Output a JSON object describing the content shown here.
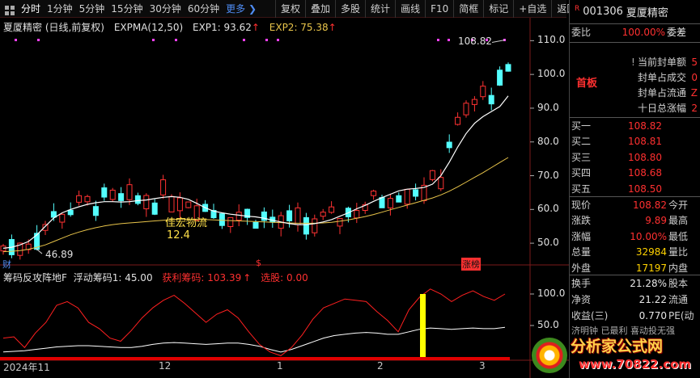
{
  "toolbar": {
    "periods": [
      "分时",
      "1分钟",
      "5分钟",
      "15分钟",
      "30分钟",
      "60分钟"
    ],
    "more": "更多 ❯",
    "actions": [
      "复权",
      "叠加",
      "多股",
      "统计",
      "画线",
      "F10",
      "简框",
      "标记",
      "+自选",
      "返回"
    ]
  },
  "chart": {
    "title": "夏厦精密 (日线,前复权)",
    "indicator": "EXPMA(12,50)",
    "exp1_label": "EXP1: 93.62",
    "exp2_label": "EXP2: 75.38",
    "arrow_up": "↑",
    "high_label": "108.82",
    "low_label": "46.89",
    "annotation_name": "佳宏物流",
    "annotation_value": "12.4",
    "marker_cai": "财",
    "marker_s": "$",
    "marker_zhangbang": "涨榜",
    "price_axis": [
      "110.0",
      "100.0",
      "90.0",
      "80.0",
      "70.0",
      "60.0",
      "50.0"
    ],
    "colors": {
      "up": "#ff3232",
      "down": "#54ffff",
      "exp1": "#ffffff",
      "exp2": "#e8c44a",
      "magenta": "#ff40ff"
    }
  },
  "indicator": {
    "title": "筹码反攻阵地F",
    "float_label": "浮动筹码1: 45.00",
    "profit_label": "获利筹码: 103.39",
    "select_label": "选股: 0.00",
    "axis": [
      "100.0",
      "50.0"
    ],
    "x_labels": [
      "2024年11",
      "12",
      "1",
      "2",
      "3"
    ]
  },
  "chart_data": {
    "type": "line",
    "ylim": [
      45,
      112
    ],
    "series": [
      {
        "name": "EXP1",
        "values": [
          48.5,
          48.8,
          49.5,
          50.5,
          52.5,
          55,
          57.5,
          59,
          60,
          60.8,
          61.5,
          62,
          62.3,
          62.3,
          62.2,
          62.3,
          62.6,
          62.8,
          63.2,
          63.6,
          63.8,
          63.6,
          63,
          61.8,
          60.5,
          59.5,
          59,
          58.6,
          58.3,
          58,
          57.8,
          57.4,
          56.8,
          56.3,
          55.8,
          55.5,
          55.5,
          55.8,
          56.3,
          57,
          58,
          59,
          60.2,
          61.2,
          62.4,
          63.5,
          64.5,
          65.5,
          66,
          66.2,
          66.5,
          67.5,
          70,
          74,
          78.5,
          82.5,
          85.5,
          87.5,
          89,
          90.5,
          93.62
        ]
      },
      {
        "name": "EXP2",
        "values": [
          47.5,
          47.6,
          47.8,
          48.2,
          48.8,
          49.5,
          50.5,
          51.5,
          52.5,
          53.3,
          54,
          54.6,
          55.1,
          55.5,
          55.8,
          56,
          56.2,
          56.4,
          56.6,
          56.8,
          57,
          57.1,
          57.1,
          57.1,
          57,
          56.9,
          56.8,
          56.7,
          56.6,
          56.5,
          56.4,
          56.3,
          56.2,
          56.1,
          56,
          55.9,
          55.9,
          55.9,
          56,
          56.2,
          56.5,
          56.9,
          57.4,
          57.9,
          58.5,
          59.2,
          59.9,
          60.6,
          61.3,
          62,
          62.7,
          63.4,
          64.3,
          65.4,
          66.7,
          68.1,
          69.5,
          70.9,
          72.4,
          73.9,
          75.38
        ]
      }
    ]
  },
  "panel": {
    "code": "001306",
    "name": "夏厦精密",
    "r_badge": "R",
    "weibi_label": "委比",
    "weibi_value": "100.00%",
    "weicha_label": "委差",
    "seal_rows": [
      {
        "label": "当前封单额",
        "value": "5"
      },
      {
        "label": "封单占成交",
        "value": "0"
      },
      {
        "label": "封单占流通",
        "value": "Z"
      },
      {
        "label": "十日总涨幅",
        "value": "2"
      }
    ],
    "seal_warn": "!",
    "board": "首板",
    "bids": [
      {
        "label": "买一",
        "price": "108.82"
      },
      {
        "label": "买二",
        "price": "108.81"
      },
      {
        "label": "买三",
        "price": "108.80"
      },
      {
        "label": "买四",
        "price": "108.68"
      },
      {
        "label": "买五",
        "price": "108.50"
      }
    ],
    "quote": [
      {
        "label": "现价",
        "value": "108.82",
        "label2": "今开"
      },
      {
        "label": "涨跌",
        "value": "9.89",
        "label2": "最高"
      },
      {
        "label": "涨幅",
        "value": "10.00%",
        "label2": "最低"
      },
      {
        "label": "总量",
        "value": "32984",
        "label2": "量比"
      },
      {
        "label": "外盘",
        "value": "17197",
        "label2": "内盘"
      }
    ],
    "stats": [
      {
        "label": "换手",
        "value": "21.28%",
        "label2": "股本"
      },
      {
        "label": "净资",
        "value": "21.22",
        "label2": "流通"
      },
      {
        "label": "收益(三)",
        "value": "0.770",
        "label2": "PE(动"
      }
    ],
    "bottom_text": "济明钟 已最利 喜动投无强"
  },
  "watermark": {
    "text": "分析家公式网",
    "url": "www.70822.com"
  }
}
